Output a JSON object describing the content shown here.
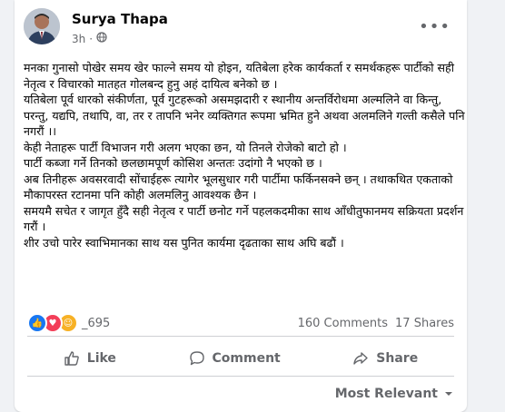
{
  "post": {
    "author": "Surya Thapa",
    "time": "3h",
    "privacy_icon": "globe-icon",
    "paragraphs": [
      "मनका गुनासो पोखेर समय खेर फाल्ने समय यो होइन, यतिबेला हरेक कार्यकर्ता र समर्थकहरू पार्टीको सही नेतृत्व र विचारको मातहत गोलबन्द हुनु अहं दायित्व बनेको छ ।",
      "यतिबेला पूर्व धारको संकीर्णता, पूर्व गुटहरूको असमझदारी र स्थानीय अन्तर्विरोधमा अल्मलिने वा किन्तु, परन्तु, यद्यपि, तथापि, वा, तर र तापनि भनेर व्यक्तिगत रूपमा भ्रमित हुने अथवा अलमलिने गल्ती कसैले पनि नगरौं ।।",
      "केही नेताहरू पार्टी विभाजन गरी अलग भएका छन, यो तिनले रोजेको बाटो हो ।",
      "पार्टी कब्जा गर्ने तिनको छलछामपूर्ण कोसिश अन्ततः उदांगो नै भएको छ ।",
      "अब तिनीहरू अवसरवादी सोंचाईहरू त्यागेर भूलसुधार गरी पार्टीमा फर्किनसक्ने छन् । तथाकथित एकताको मौकापरस्त  रटानमा पनि कोही अलमलिनु आवश्यक छैन ।",
      "समयमै सचेत र जागृत हुँदै सही नेतृत्व र पार्टी छनोट गर्ने पहलकदमीका साथ आँधीतुफानमय सक्रियता प्रदर्शन गरौं ।",
      " शीर उचो पारेर स्वाभिमानका साथ यस पुनित कार्यमा दृढताका साथ अघि बढौं ।"
    ]
  },
  "stats": {
    "reaction_count": "_695",
    "comments": "160 Comments",
    "shares": "17 Shares"
  },
  "actions": {
    "like": "Like",
    "comment": "Comment",
    "share": "Share"
  },
  "sort_label": "Most Relevant",
  "colors": {
    "like_blue": "#1877f2",
    "love_red": "#f33e58",
    "haha_yellow": "#f7b125",
    "secondary_text": "#65676b"
  }
}
